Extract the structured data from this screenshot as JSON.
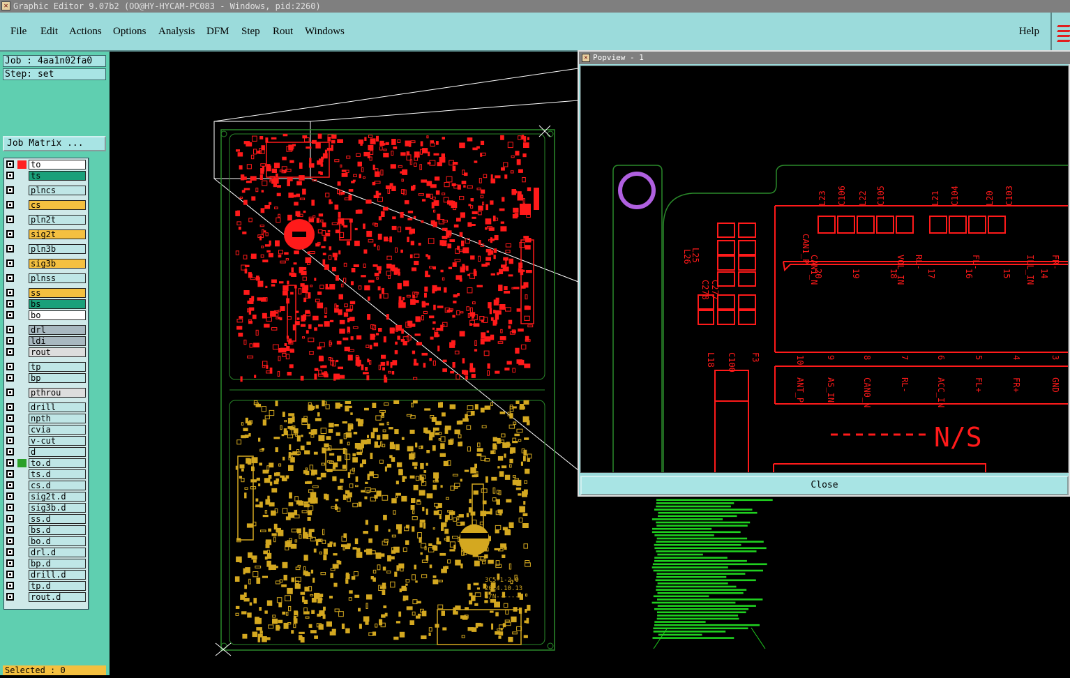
{
  "window": {
    "title": "Graphic Editor 9.07b2 (OO@HY-HYCAM-PC083 - Windows, pid:2260)"
  },
  "menu": {
    "items": [
      "File",
      "Edit",
      "Actions",
      "Options",
      "Analysis",
      "DFM",
      "Step",
      "Rout",
      "Windows"
    ],
    "help": "Help"
  },
  "job": {
    "label": "Job : 4aa1n02fa0",
    "step": "Step: set",
    "matrix_button": "Job Matrix ..."
  },
  "layers": [
    {
      "name": "to",
      "color": "#ffffff",
      "swatch": "#ff2020",
      "mark": "▣"
    },
    {
      "name": "ts",
      "color": "#1aa07a"
    },
    {
      "name": "plncs",
      "color": "#bfe6e6"
    },
    {
      "name": "cs",
      "color": "#f4c040"
    },
    {
      "name": "pln2t",
      "color": "#bfe6e6"
    },
    {
      "name": "sig2t",
      "color": "#f4c040"
    },
    {
      "name": "pln3b",
      "color": "#bfe6e6"
    },
    {
      "name": "sig3b",
      "color": "#f4c040"
    },
    {
      "name": "plnss",
      "color": "#bfe6e6"
    },
    {
      "name": "ss",
      "color": "#f4c040"
    },
    {
      "name": "bs",
      "color": "#1aa07a"
    },
    {
      "name": "bo",
      "color": "#ffffff"
    },
    {
      "name": "drl",
      "color": "#a8b8c0"
    },
    {
      "name": "ldi",
      "color": "#a8b8c0"
    },
    {
      "name": "rout",
      "color": "#dddddd"
    },
    {
      "name": "tp",
      "color": "#bfe6e6"
    },
    {
      "name": "bp",
      "color": "#bfe6e6"
    },
    {
      "name": "pthrou",
      "color": "#dddddd"
    },
    {
      "name": "drill",
      "color": "#bfe6e6"
    },
    {
      "name": "npth",
      "color": "#bfe6e6"
    },
    {
      "name": "cvia",
      "color": "#bfe6e6"
    },
    {
      "name": "v-cut",
      "color": "#bfe6e6"
    },
    {
      "name": "d",
      "color": "#bfe6e6"
    },
    {
      "name": "to.d",
      "color": "#bfe6e6",
      "swatch": "#2aa02a",
      "mark": "✎"
    },
    {
      "name": "ts.d",
      "color": "#bfe6e6"
    },
    {
      "name": "cs.d",
      "color": "#bfe6e6"
    },
    {
      "name": "sig2t.d",
      "color": "#bfe6e6"
    },
    {
      "name": "sig3b.d",
      "color": "#bfe6e6"
    },
    {
      "name": "ss.d",
      "color": "#bfe6e6"
    },
    {
      "name": "bs.d",
      "color": "#bfe6e6"
    },
    {
      "name": "bo.d",
      "color": "#bfe6e6",
      "mark": "✎"
    },
    {
      "name": "drl.d",
      "color": "#bfe6e6"
    },
    {
      "name": "bp.d",
      "color": "#bfe6e6"
    },
    {
      "name": "drill.d",
      "color": "#bfe6e6"
    },
    {
      "name": "tp.d",
      "color": "#bfe6e6"
    },
    {
      "name": "rout.d",
      "color": "#bfe6e6"
    }
  ],
  "status": {
    "selected": "Selected : 0"
  },
  "board": {
    "label_code": "3C5-1-2.0",
    "label_date": "2014.10.13",
    "label_sn": "S/N------"
  },
  "popview": {
    "title": "Popview - 1",
    "close": "Close",
    "refs_top": [
      "L23",
      "C106",
      "L22",
      "C105",
      "L21",
      "C104",
      "L20",
      "C103"
    ],
    "signals_top": [
      "CAN1_N",
      "VOL_IN",
      "RL-",
      "FL-",
      "ILL_IN",
      "FR-"
    ],
    "pin_numbers_top": [
      "20",
      "19",
      "18",
      "17",
      "16",
      "15",
      "14"
    ],
    "pin_numbers_bottom": [
      "10",
      "9",
      "8",
      "7",
      "6",
      "5",
      "4",
      "3"
    ],
    "signals_bottom": [
      "ANT_P",
      "AS_IN",
      "CAN0_N",
      "RL-",
      "ACC_IN",
      "FL+",
      "FR+",
      "GND"
    ],
    "refs_left": [
      "L25",
      "L26",
      "C277",
      "C278",
      "L18",
      "C100",
      "F3",
      "CAN1_P"
    ],
    "ns_label": "N/S"
  },
  "colors": {
    "top_copper": "#ff1a1a",
    "bottom_copper": "#d4a820",
    "profile": "#2a8a2a",
    "notes": "#20d020",
    "via_ring": "#b060e0"
  }
}
